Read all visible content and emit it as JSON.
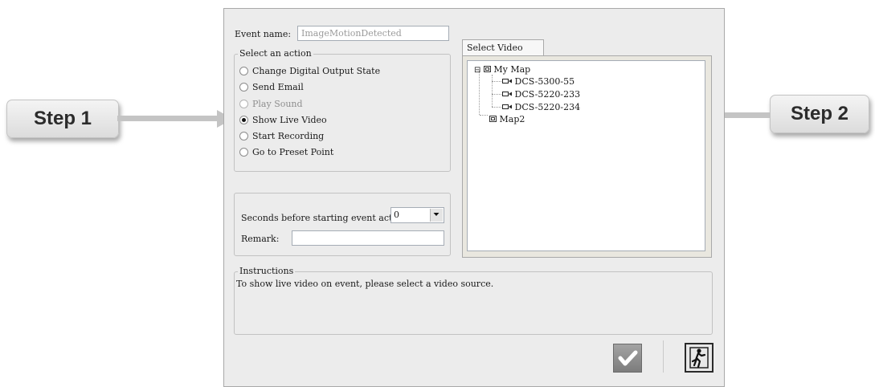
{
  "callouts": {
    "step1": "Step 1",
    "step2": "Step 2"
  },
  "event": {
    "label": "Event name:",
    "value": "ImageMotionDetected"
  },
  "action_group": {
    "legend": "Select an action",
    "options": [
      {
        "label": "Change Digital Output State",
        "checked": false,
        "enabled": true
      },
      {
        "label": "Send Email",
        "checked": false,
        "enabled": true
      },
      {
        "label": "Play Sound",
        "checked": false,
        "enabled": false
      },
      {
        "label": "Show Live Video",
        "checked": true,
        "enabled": true
      },
      {
        "label": "Start Recording",
        "checked": false,
        "enabled": true
      },
      {
        "label": "Go to Preset Point",
        "checked": false,
        "enabled": true
      }
    ]
  },
  "delay": {
    "label": "Seconds before starting event action:",
    "value": "0"
  },
  "remark": {
    "label": "Remark:",
    "value": ""
  },
  "video_source": {
    "tab_label": "Select Video Source",
    "tree": {
      "root": "My Map",
      "root_collapse_glyph": "⊟",
      "cameras": [
        "DCS-5300-55",
        "DCS-5220-233",
        "DCS-5220-234"
      ],
      "second_map": "Map2"
    }
  },
  "instructions": {
    "legend": "Instructions",
    "text": "To show live video on event, please select a video source."
  },
  "icons": {
    "ok": "check-icon",
    "exit": "exit-door-icon",
    "map": "map-icon",
    "camera": "camera-icon"
  },
  "colors": {
    "ok_button": "#8a8a8a",
    "exit_button": "#e8e8e8",
    "callout_arrow": "#c4c4c4"
  }
}
